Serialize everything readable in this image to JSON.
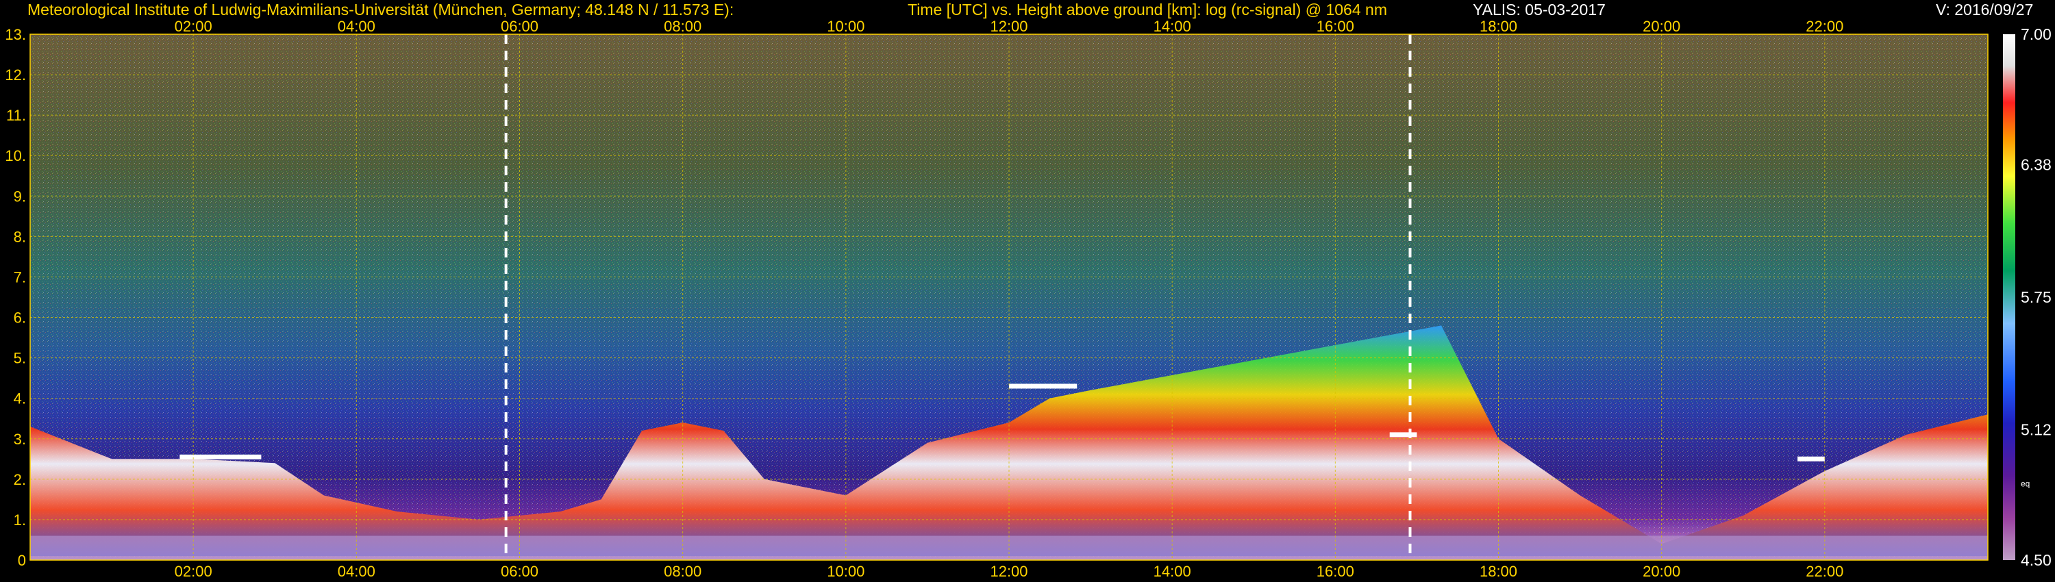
{
  "header": {
    "institute": "Meteorological Institute of Ludwig-Maximilians-Universität (München, Germany; 48.148 N / 11.573 E):",
    "description": "Time [UTC] vs. Height above ground [km]: log (rc-signal) @ 1064 nm",
    "instrument": "YALIS: 05-03-2017",
    "version": "V: 2016/09/27"
  },
  "colors": {
    "header_left": "#ffd400",
    "header_mid": "#ffd400",
    "header_right": "#ffffff",
    "grid": "#d8c400",
    "background": "#000000"
  },
  "chart_data": {
    "type": "heatmap",
    "title": "Time [UTC] vs. Height above ground [km]: log (rc-signal) @ 1064 nm",
    "xlabel": "Time [UTC]",
    "ylabel": "Height above ground [km]",
    "x_ticks": [
      "02:00",
      "04:00",
      "06:00",
      "08:00",
      "10:00",
      "12:00",
      "14:00",
      "16:00",
      "18:00",
      "20:00",
      "22:00"
    ],
    "y_ticks": [
      "0",
      "1.",
      "2.",
      "3.",
      "4.",
      "5.",
      "6.",
      "7.",
      "8.",
      "9.",
      "10.",
      "11.",
      "12.",
      "13."
    ],
    "xlim_hours": [
      0.0,
      24.0
    ],
    "ylim_km": [
      0,
      13
    ],
    "grid": true,
    "colorbar": {
      "labels": [
        "7.00",
        "6.38",
        "5.75",
        "5.12",
        "4.50"
      ],
      "range": [
        4.5,
        7.0
      ],
      "small_label": "eq"
    },
    "dashed_time_markers": [
      "05:50",
      "16:55"
    ],
    "aerosol_layer_top_km": [
      [
        0.0,
        3.3
      ],
      [
        1.0,
        2.5
      ],
      [
        2.0,
        2.5
      ],
      [
        3.0,
        2.4
      ],
      [
        3.6,
        1.6
      ],
      [
        4.5,
        1.2
      ],
      [
        5.5,
        1.0
      ],
      [
        6.5,
        1.2
      ],
      [
        7.0,
        1.5
      ],
      [
        7.5,
        3.2
      ],
      [
        8.0,
        3.4
      ],
      [
        8.5,
        3.2
      ],
      [
        9.0,
        2.0
      ],
      [
        10.0,
        1.6
      ],
      [
        11.0,
        2.9
      ],
      [
        12.0,
        3.4
      ],
      [
        12.5,
        4.0
      ],
      [
        13.0,
        4.2
      ],
      [
        17.3,
        5.8
      ],
      [
        18.0,
        3.0
      ],
      [
        19.0,
        1.6
      ],
      [
        20.0,
        0.4
      ],
      [
        21.0,
        1.1
      ],
      [
        22.0,
        2.2
      ],
      [
        23.0,
        3.1
      ],
      [
        24.0,
        3.6
      ]
    ],
    "cloud_segments": [
      {
        "start": "01:50",
        "end": "02:50",
        "height_km": 2.55
      },
      {
        "start": "12:00",
        "end": "12:50",
        "height_km": 4.3
      },
      {
        "start": "16:40",
        "end": "17:00",
        "height_km": 3.1
      },
      {
        "start": "21:40",
        "end": "22:00",
        "height_km": 2.5
      }
    ]
  }
}
